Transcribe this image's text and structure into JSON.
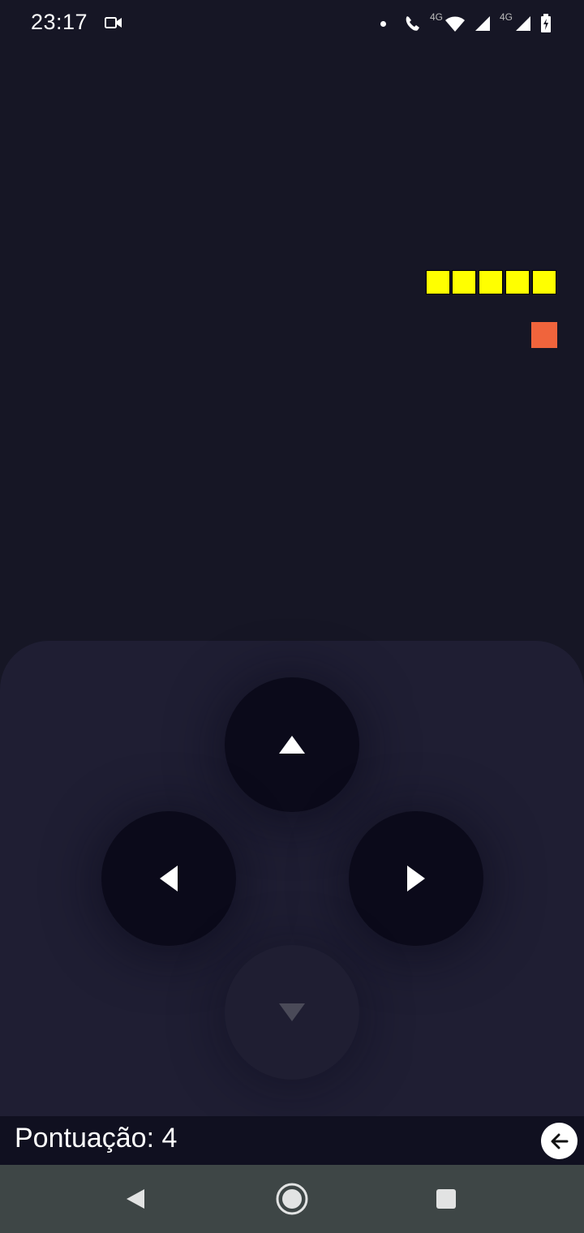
{
  "status_bar": {
    "time": "23:17",
    "network_label_1": "4G",
    "network_label_2": "4G",
    "icons": [
      "video-camera-icon",
      "notification-dot-icon",
      "wifi-calling-icon",
      "wifi-icon",
      "signal-icon",
      "signal-icon",
      "battery-charging-icon"
    ]
  },
  "game": {
    "snake_color": "#ffff00",
    "food_color": "#f0643c",
    "snake_length": 5
  },
  "controls": {
    "up": "arrow-up-icon",
    "left": "arrow-left-icon",
    "right": "arrow-right-icon",
    "down": "arrow-down-icon",
    "down_disabled": true
  },
  "score": {
    "text": "Pontuação: 4"
  },
  "nav": {
    "icons": [
      "back-triangle-icon",
      "home-circle-icon",
      "recents-square-icon"
    ]
  }
}
